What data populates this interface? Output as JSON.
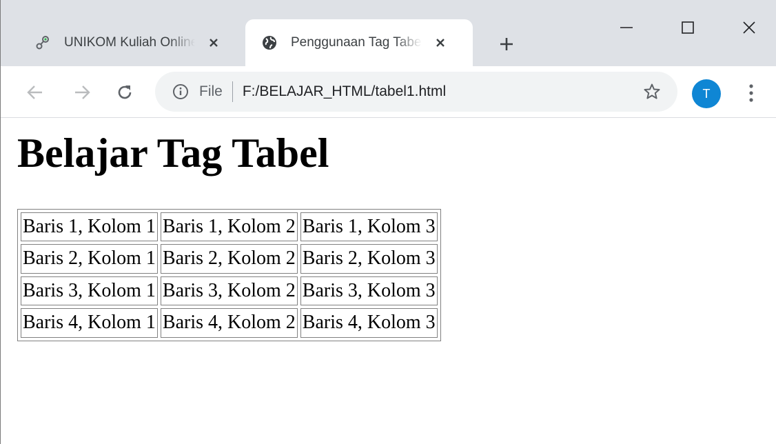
{
  "browser": {
    "tabs": [
      {
        "title": "UNIKOM Kuliah Online",
        "favicon": "link-icon",
        "active": false
      },
      {
        "title": "Penggunaan Tag Tabel",
        "favicon": "globe-icon",
        "active": true
      }
    ],
    "address": {
      "chip": "File",
      "url": "F:/BELAJAR_HTML/tabel1.html"
    },
    "profile_initial": "T",
    "colors": {
      "tabstrip": "#dee1e6",
      "omnibox": "#f1f3f4",
      "avatar": "#0f86d4"
    }
  },
  "page": {
    "heading": "Belajar Tag Tabel",
    "table": {
      "rows": [
        [
          "Baris 1, Kolom 1",
          "Baris 1, Kolom 2",
          "Baris 1, Kolom 3"
        ],
        [
          "Baris 2, Kolom 1",
          "Baris 2, Kolom 2",
          "Baris 2, Kolom 3"
        ],
        [
          "Baris 3, Kolom 1",
          "Baris 3, Kolom 2",
          "Baris 3, Kolom 3"
        ],
        [
          "Baris 4, Kolom 1",
          "Baris 4, Kolom 2",
          "Baris 4, Kolom 3"
        ]
      ]
    }
  }
}
